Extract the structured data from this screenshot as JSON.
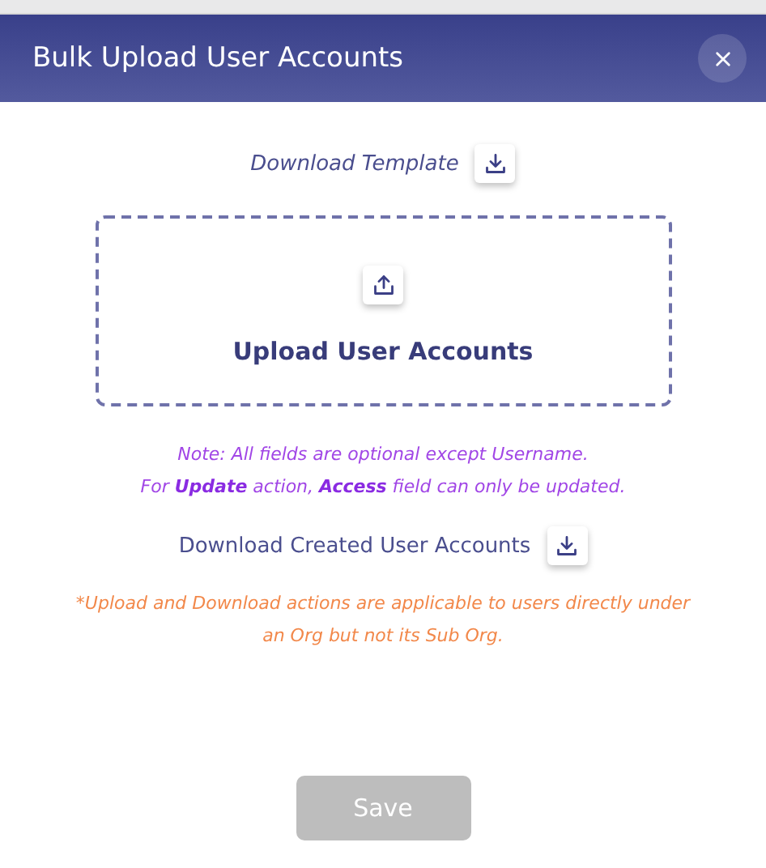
{
  "dialog": {
    "title": "Bulk Upload User Accounts"
  },
  "download_template": {
    "label": "Download Template"
  },
  "upload_area": {
    "label": "Upload User Accounts"
  },
  "note_lines": [
    "Note: All fields are optional except Username.",
    "For **Update** action, **Access** field can only be updated."
  ],
  "download_created": {
    "label": "Download Created User Accounts"
  },
  "footnote": "*Upload and Download actions are applicable to users directly under an Org but not its Sub Org.",
  "save_button": {
    "label": "Save",
    "disabled": true
  }
}
